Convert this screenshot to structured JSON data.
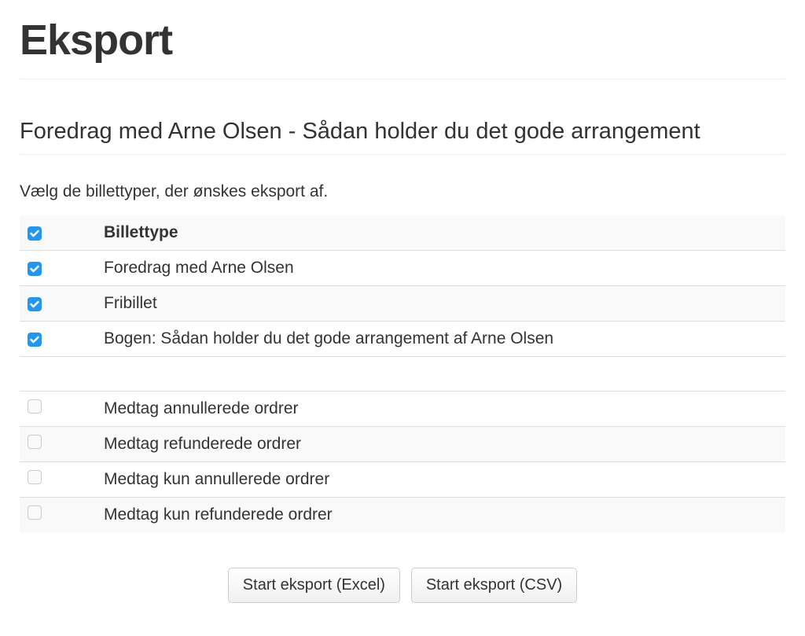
{
  "page_title": "Eksport",
  "event_title": "Foredrag med Arne Olsen - Sådan holder du det gode arrangement",
  "instruction": "Vælg de billettyper, der ønskes eksport af.",
  "table": {
    "header_label": "Billettype",
    "ticket_types": [
      {
        "label": "Foredrag med Arne Olsen",
        "checked": true
      },
      {
        "label": "Fribillet",
        "checked": true
      },
      {
        "label": "Bogen: Sådan holder du det gode arrangement af Arne Olsen",
        "checked": true
      }
    ],
    "options": [
      {
        "label": "Medtag annullerede ordrer",
        "checked": false
      },
      {
        "label": "Medtag refunderede ordrer",
        "checked": false
      },
      {
        "label": "Medtag kun annullerede ordrer",
        "checked": false
      },
      {
        "label": "Medtag kun refunderede ordrer",
        "checked": false
      }
    ]
  },
  "buttons": {
    "export_excel": "Start eksport (Excel)",
    "export_csv": "Start eksport (CSV)"
  }
}
